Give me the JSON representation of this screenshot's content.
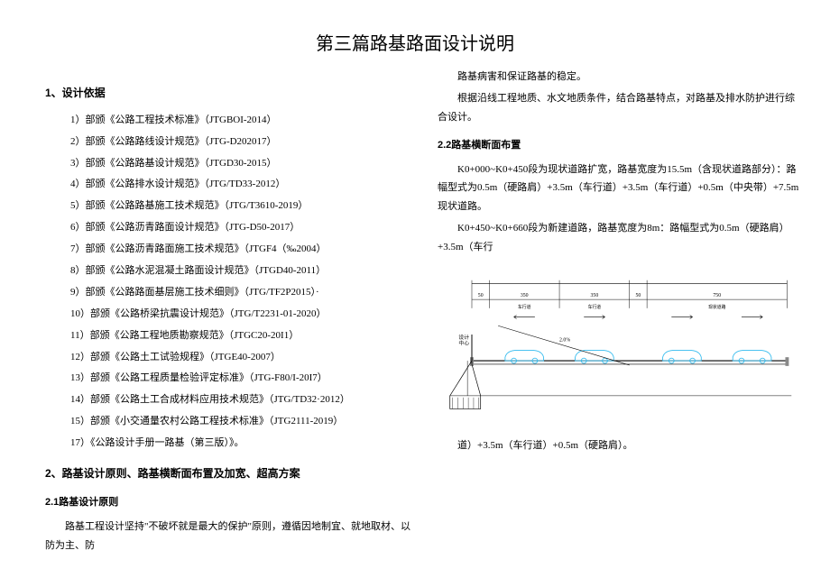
{
  "title": "第三篇路基路面设计说明",
  "left": {
    "h1_1": "1、设计依据",
    "refs": [
      "1）部颁《公路工程技术标准》（JTGBOI-2014）",
      "2）部颁《公路路线设计规范》（JTG-D202017）",
      "3）部颁《公路路基设计规范》（JTGD30-2015）",
      "4）部颁《公路排水设计规范》（JTG/TD33-2012）",
      "5）部颁《公路路基施工技术规范》（JTG/T3610-2019）",
      "6）部颁《公路沥青路面设计规范》（JTG-D50-2017）",
      "7）部颁《公路沥青路面施工技术规范》（JTGF4（‰2004）",
      "8）部颁《公路水泥混凝土路面设计规范》（JTGD40-2011）",
      "9）部颁《公路路面基层施工技术细则》（JTG/TF2P2015）·",
      "10）部颁《公路桥梁抗震设计规范》（JTG/T2231-01-2020）",
      "11）部颁《公路工程地质勘察规范》（JTGC20-20I1）",
      "12）部颁《公路土工试验规程》（JTGE40-2007）",
      "13）部颁《公路工程质量检验评定标准》（JTG-F80/I-20I7）",
      "14）部颁《公路土工合成材料应用技术规范》（JTG/TD32·2012）",
      "15）部颁《小交通量农村公路工程技术标准》（JTG2111-2019）",
      "17）《公路设计手册一路基（第三版）》。"
    ],
    "h1_2": "2、路基设计原则、路基横断面布置及加宽、超高方案",
    "h2_1": "2.1路基设计原则",
    "p1": "路基工程设计坚持\"不破坏就是最大的保护\"原则，遵循因地制宜、就地取材、以防为主、防"
  },
  "right": {
    "p1": "路基病害和保证路基的稳定。",
    "p2": "根据沿线工程地质、水文地质条件，结合路基特点，对路基及排水防护进行综合设计。",
    "h2_1": "2.2路基横断面布置",
    "p3": "K0+000~K0+450段为现状道路扩宽，路基宽度为15.5m（含现状道路部分）：路幅型式为0.5m（硬路肩）+3.5m（车行道）+3.5m（车行道）+0.5m（中央带）+7.5m现状道路。",
    "p4": "K0+450~K0+660段为新建道路，路基宽度为8m：路幅型式为0.5m（硬路肩）+3.5m（车行",
    "p5": "道）+3.5m（车行道）+0.5m（硬路肩）。"
  },
  "chart_data": {
    "type": "diagram",
    "description": "road cross-section",
    "lanes": [
      "0.5m",
      "3.5m",
      "3.5m",
      "0.5m",
      "7.5m"
    ],
    "labels": [
      "硬路肩",
      "车行道",
      "车行道",
      "中央带",
      "现状道路"
    ],
    "total_width_m": 15.5,
    "grade_percent": 2.0
  }
}
